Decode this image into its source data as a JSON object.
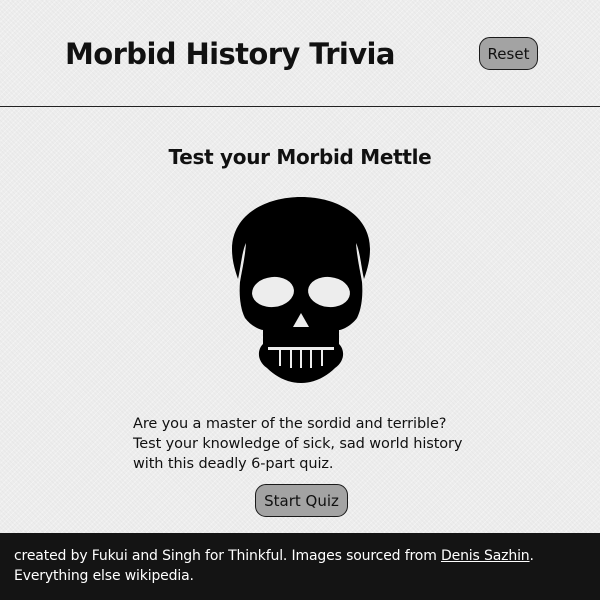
{
  "header": {
    "title": "Morbid History Trivia",
    "reset_label": "Reset"
  },
  "main": {
    "heading": "Test your Morbid Mettle",
    "image_icon": "skull-icon",
    "intro_text": "Are you a master of the sordid and terrible? Test your knowledge of sick, sad world history with this deadly 6-part quiz.",
    "start_label": "Start Quiz"
  },
  "footer": {
    "text_before_link": "created by Fukui and Singh for Thinkful. Images sourced from ",
    "link_text": "Denis Sazhin",
    "text_after_link": ". Everything else wikipedia."
  },
  "colors": {
    "page_background": "#ededed",
    "button_background": "#a3a3a3",
    "footer_background": "#141414",
    "text": "#111111"
  }
}
